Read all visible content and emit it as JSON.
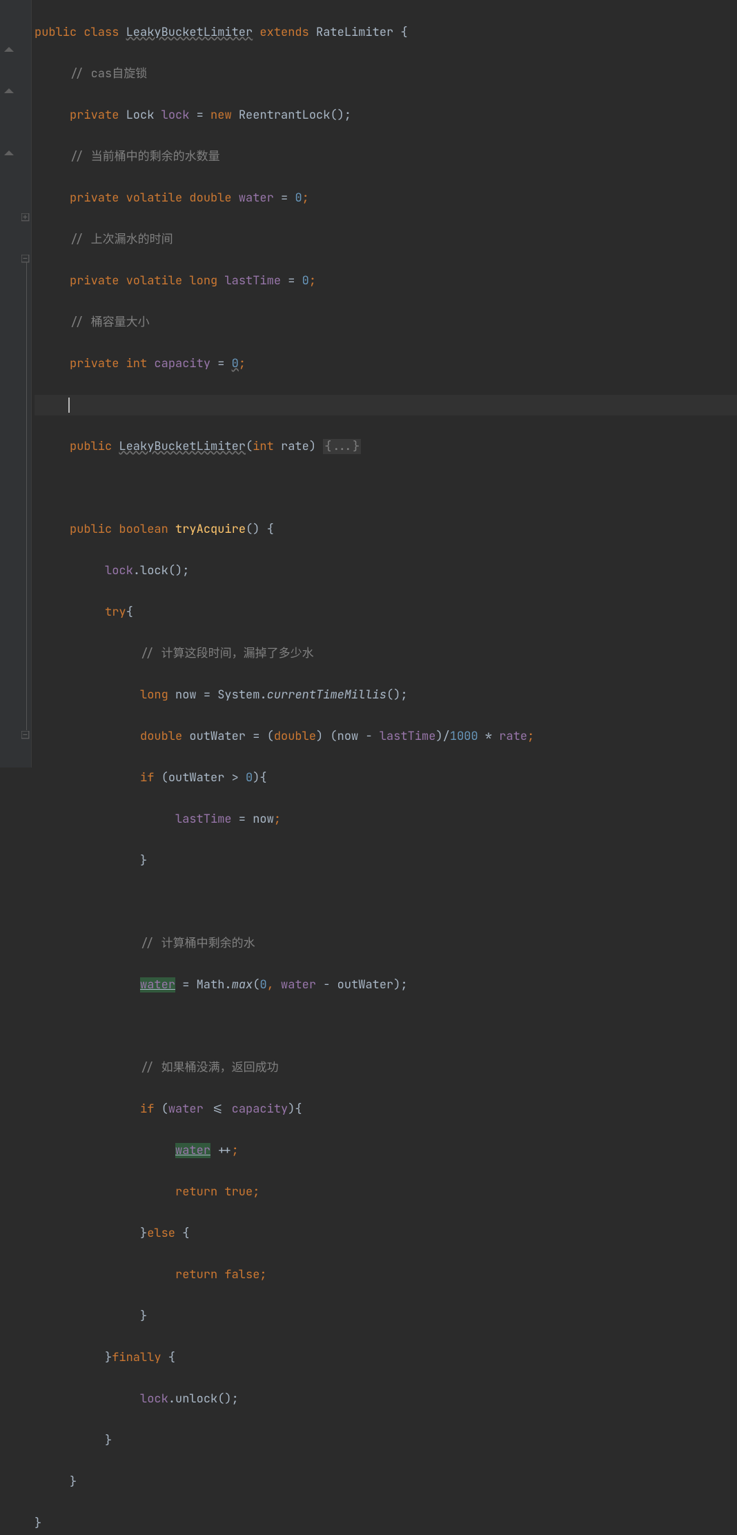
{
  "code": {
    "l1": {
      "kw1": "public",
      "kw2": "class",
      "cls": "LeakyBucketLimiter",
      "kw3": "extends",
      "sup": "RateLimiter",
      "ob": "{"
    },
    "l2": {
      "c": "// cas自旋锁"
    },
    "l3": {
      "kw": "private",
      "t": "Lock",
      "f": "lock",
      "eq": "=",
      "kw2": "new",
      "ctor": "ReentrantLock",
      "p": "();"
    },
    "l4": {
      "c": "// 当前桶中的剩余的水数量"
    },
    "l5": {
      "kw": "private",
      "kw2": "volatile",
      "kw3": "double",
      "f": "water",
      "eq": "=",
      "n": "0",
      "sc": ";"
    },
    "l6": {
      "c": "// 上次漏水的时间"
    },
    "l7": {
      "kw": "private",
      "kw2": "volatile",
      "kw3": "long",
      "f": "lastTime",
      "eq": "=",
      "n": "0",
      "sc": ";"
    },
    "l8": {
      "c": "// 桶容量大小"
    },
    "l9": {
      "kw": "private",
      "kw2": "int",
      "f": "capacity",
      "eq": "=",
      "n": "0",
      "sc": ";"
    },
    "l11": {
      "kw": "public",
      "cls": "LeakyBucketLimiter",
      "lp": "(",
      "kw2": "int",
      "p": "rate",
      "rp": ") ",
      "fold": "{...}"
    },
    "l13": {
      "kw": "public",
      "kw2": "boolean",
      "m": "tryAcquire",
      "p": "() {"
    },
    "l14": {
      "f": "lock",
      "dot": ".",
      "m": "lock",
      "p": "();"
    },
    "l15": {
      "kw": "try",
      "ob": "{"
    },
    "l16": {
      "c": "// 计算这段时间，漏掉了多少水"
    },
    "l17": {
      "kw": "long",
      "v": "now",
      "eq": " = ",
      "cls": "System",
      "dot": ".",
      "m": "currentTimeMillis",
      "p": "();"
    },
    "l18": {
      "kw": "double",
      "v": "outWater",
      "eq": " = ",
      "lp": "(",
      "kw2": "double",
      "rp": ") (",
      "v2": "now",
      "op": " - ",
      "f": "lastTime",
      "rp2": ")/",
      "n": "1000",
      "op2": " * ",
      "f2": "rate",
      "sc": ";"
    },
    "l19": {
      "kw": "if",
      "lp": " (",
      "v": "outWater",
      "op": " > ",
      "n": "0",
      "rp": "){"
    },
    "l20": {
      "f": "lastTime",
      "eq": " = ",
      "v": "now",
      "sc": ";"
    },
    "l21": {
      "cb": "}"
    },
    "l23": {
      "c": "// 计算桶中剩余的水"
    },
    "l24": {
      "f": "water",
      "eq": " = ",
      "cls": "Math",
      "dot": ".",
      "m": "max",
      "lp": "(",
      "n": "0",
      "com": ",",
      "sp": " ",
      "f2": "water",
      "op": " - ",
      "v": "outWater",
      "rp": ");"
    },
    "l26": {
      "c": "// 如果桶没满，返回成功"
    },
    "l27": {
      "kw": "if",
      "lp": " (",
      "f": "water",
      "op": " <= ",
      "f2": "capacity",
      "rp": "){"
    },
    "l28": {
      "f": "water",
      "op": " ++",
      "sc": ";"
    },
    "l29": {
      "kw": "return",
      "sp": " ",
      "kw2": "true",
      "sc": ";"
    },
    "l30": {
      "cb": "}",
      "kw": "else",
      "ob": " {"
    },
    "l31": {
      "kw": "return",
      "sp": " ",
      "kw2": "false",
      "sc": ";"
    },
    "l32": {
      "cb": "}"
    },
    "l33": {
      "cb": "}",
      "kw": "finally",
      "ob": " {"
    },
    "l34": {
      "f": "lock",
      "dot": ".",
      "m": "unlock",
      "p": "();"
    },
    "l35": {
      "cb": "}"
    },
    "l36": {
      "cb": "}"
    },
    "l37": {
      "cb": "}"
    }
  },
  "indent": {
    "i0": "",
    "i1": "     ",
    "i2": "          ",
    "i3": "               ",
    "i4": "                    ",
    "i5": "                         "
  }
}
